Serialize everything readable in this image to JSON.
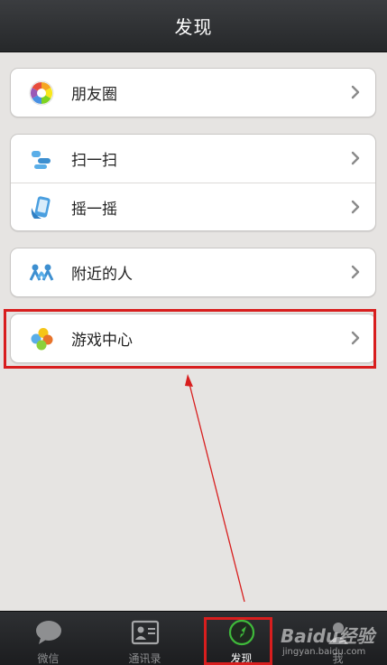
{
  "header": {
    "title": "发现"
  },
  "groups": [
    {
      "items": [
        {
          "label": "朋友圈",
          "icon": "moments-aperture-icon"
        }
      ]
    },
    {
      "items": [
        {
          "label": "扫一扫",
          "icon": "scan-hand-icon"
        },
        {
          "label": "摇一摇",
          "icon": "shake-phone-icon"
        }
      ]
    },
    {
      "items": [
        {
          "label": "附近的人",
          "icon": "people-nearby-icon"
        }
      ]
    },
    {
      "items": [
        {
          "label": "游戏中心",
          "icon": "game-center-icon"
        }
      ]
    }
  ],
  "tabbar": {
    "tabs": [
      {
        "label": "微信",
        "icon": "chat-bubble-icon"
      },
      {
        "label": "通讯录",
        "icon": "contacts-card-icon"
      },
      {
        "label": "发现",
        "icon": "compass-icon",
        "active": true
      },
      {
        "label": "我",
        "icon": "person-icon"
      }
    ]
  },
  "watermark": {
    "brand": "Baidu经验",
    "url": "jingyan.baidu.com"
  },
  "colors": {
    "highlight": "#d81e1e",
    "accent_green": "#3fb93b",
    "background": "#e6e4e2"
  }
}
